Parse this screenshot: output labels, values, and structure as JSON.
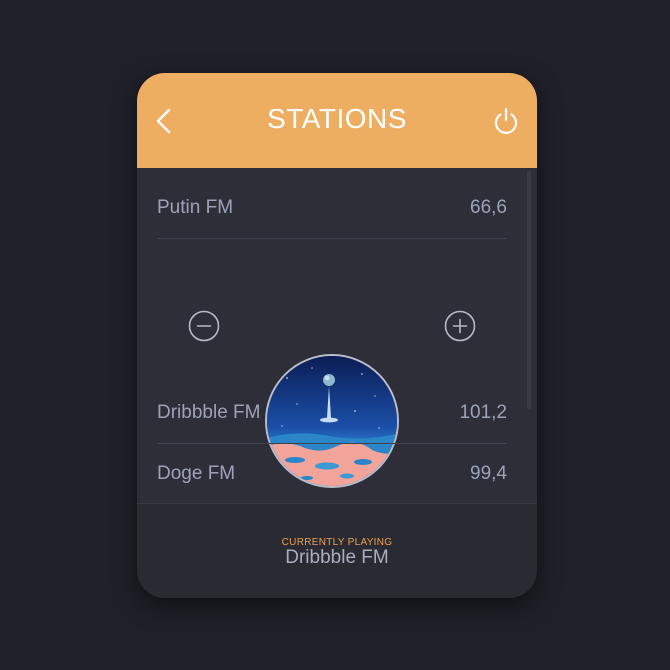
{
  "header": {
    "title": "STATIONS",
    "back_icon": "chevron-left-icon",
    "power_icon": "power-icon"
  },
  "stations": [
    {
      "name": "Putin FM",
      "frequency": "66,6"
    },
    {
      "name": "Dribbble FM",
      "frequency": "101,2"
    },
    {
      "name": "Doge FM",
      "frequency": "99,4"
    }
  ],
  "controls": {
    "decrease_icon": "minus-circle-icon",
    "increase_icon": "plus-circle-icon"
  },
  "footer": {
    "label": "CURRENTLY PLAYING",
    "station": "Dribbble FM"
  },
  "colors": {
    "background": "#20202a",
    "header": "#eeae62",
    "card": "#2e2e39",
    "footer": "#2a2a33",
    "text": "#9da3b6",
    "accent": "#eea150"
  }
}
